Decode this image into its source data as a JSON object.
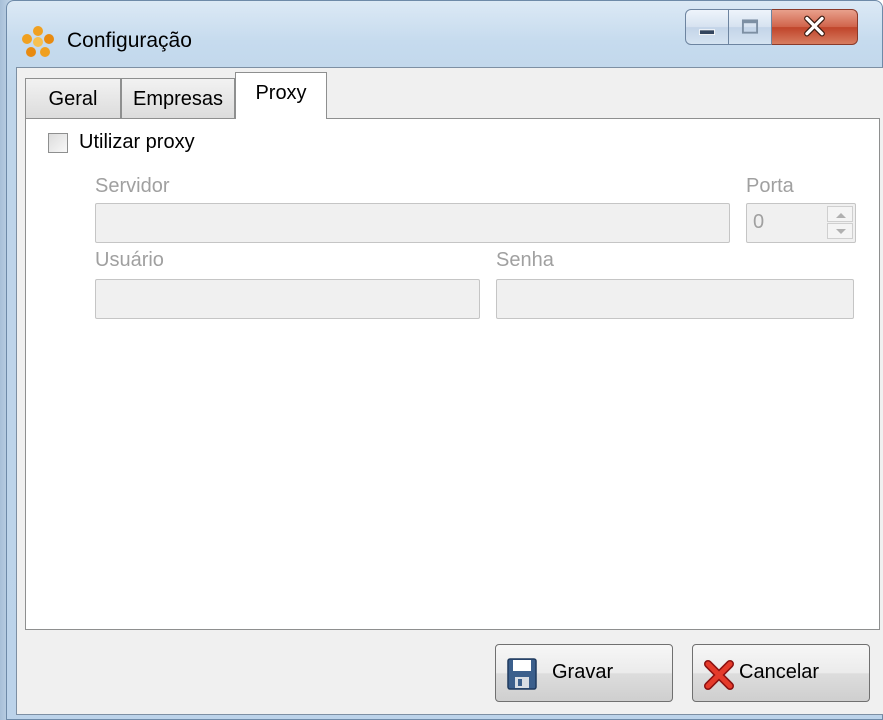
{
  "window": {
    "title": "Configuração"
  },
  "tabs": [
    {
      "label": "Geral",
      "selected": false
    },
    {
      "label": "Empresas",
      "selected": false
    },
    {
      "label": "Proxy",
      "selected": true
    }
  ],
  "proxy": {
    "use_proxy_label": "Utilizar proxy",
    "use_proxy_checked": false,
    "server_label": "Servidor",
    "server_value": "",
    "port_label": "Porta",
    "port_value": "0",
    "user_label": "Usuário",
    "user_value": "",
    "password_label": "Senha",
    "password_value": "",
    "fields_enabled": false
  },
  "buttons": {
    "save_label": "Gravar",
    "cancel_label": "Cancelar"
  },
  "icons": {
    "app": "orange-flower-icon",
    "save": "floppy-disk-icon",
    "cancel": "red-x-icon"
  },
  "colors": {
    "title_bar": "#c6dbee",
    "close_button": "#c0442a",
    "disabled_text": "#a0a0a0",
    "disabled_field": "#f0f0f0"
  }
}
